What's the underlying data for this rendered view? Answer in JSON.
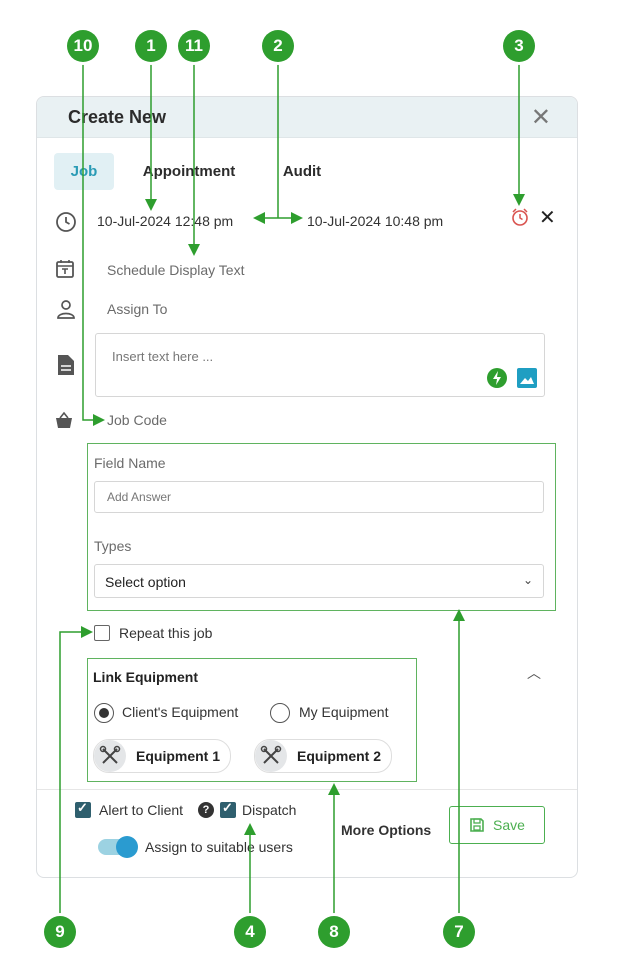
{
  "dialog": {
    "title": "Create New",
    "tabs": [
      {
        "label": "Job",
        "active": true
      },
      {
        "label": "Appointment",
        "active": false
      },
      {
        "label": "Audit",
        "active": false
      }
    ],
    "start_datetime": "10-Jul-2024 12:48 pm",
    "end_datetime": "10-Jul-2024 10:48 pm",
    "schedule_display_placeholder": "Schedule Display Text",
    "assign_to_placeholder": "Assign To",
    "notes_placeholder": "Insert text here ...",
    "job_code_placeholder": "Job Code",
    "custom_field": {
      "label": "Field Name",
      "answer_placeholder": "Add Answer",
      "types_label": "Types",
      "types_value": "Select option"
    },
    "repeat_label": "Repeat this job",
    "repeat_checked": false,
    "link_equipment": {
      "title": "Link Equipment",
      "options": [
        {
          "label": "Client's Equipment",
          "selected": true
        },
        {
          "label": "My Equipment",
          "selected": false
        }
      ],
      "items": [
        "Equipment 1",
        "Equipment 2"
      ]
    },
    "footer": {
      "alert_label": "Alert to Client",
      "alert_checked": true,
      "dispatch_label": "Dispatch",
      "dispatch_checked": true,
      "assign_label": "Assign to suitable users",
      "assign_on": true,
      "more_options": "More Options",
      "save_label": "Save"
    }
  },
  "markers": [
    "10",
    "1",
    "11",
    "2",
    "3",
    "9",
    "4",
    "8",
    "7"
  ],
  "colors": {
    "marker": "#2e9e2e",
    "accent": "#2a9bb5",
    "save": "#4caf50",
    "header_bg": "#e9f1f3"
  }
}
